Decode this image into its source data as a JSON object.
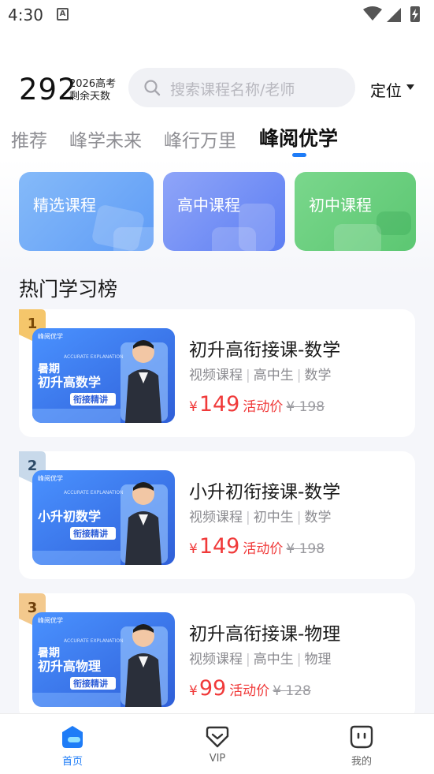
{
  "status_bar": {
    "time": "4:30",
    "notification_icon": "A"
  },
  "header": {
    "countdown_number": "292",
    "countdown_line1": "2026高考",
    "countdown_line2": "剩余天数",
    "search_placeholder": "搜索课程名称/老师",
    "location_label": "定位"
  },
  "tabs": [
    {
      "label": "推荐",
      "active": false
    },
    {
      "label": "峰学未来",
      "active": false
    },
    {
      "label": "峰行万里",
      "active": false
    },
    {
      "label": "峰阅优学",
      "active": true
    }
  ],
  "categories": [
    {
      "label": "精选课程",
      "color": "#6aa6f8"
    },
    {
      "label": "高中课程",
      "color": "#6f8cf5"
    },
    {
      "label": "初中课程",
      "color": "#6cd07f"
    }
  ],
  "section_title": "热门学习榜",
  "courses": [
    {
      "rank": "1",
      "title": "初升高衔接课-数学",
      "tags": [
        "视频课程",
        "高中生",
        "数学"
      ],
      "price_currency": "¥",
      "price": "149",
      "price_label": "活动价",
      "original_price": "¥ 198"
    },
    {
      "rank": "2",
      "title": "小升初衔接课-数学",
      "tags": [
        "视频课程",
        "初中生",
        "数学"
      ],
      "price_currency": "¥",
      "price": "149",
      "price_label": "活动价",
      "original_price": "¥ 198"
    },
    {
      "rank": "3",
      "title": "初升高衔接课-物理",
      "tags": [
        "视频课程",
        "高中生",
        "物理"
      ],
      "price_currency": "¥",
      "price": "99",
      "price_label": "活动价",
      "original_price": "¥ 128"
    }
  ],
  "thumbs": [
    {
      "brand": "峰阅优学",
      "line1": "暑期",
      "line2": "初升高数学",
      "line3": "衔接精讲",
      "ribbon": "ACCURATE EXPLANATION"
    },
    {
      "brand": "峰阅优学",
      "line1": "",
      "line2": "小升初数学",
      "line3": "衔接精讲",
      "ribbon": "ACCURATE EXPLANATION"
    },
    {
      "brand": "峰阅优学",
      "line1": "暑期",
      "line2": "初升高物理",
      "line3": "衔接精讲",
      "ribbon": "ACCURATE EXPLANATION"
    }
  ],
  "bottom_nav": [
    {
      "label": "首页",
      "icon": "home-icon",
      "active": true
    },
    {
      "label": "VIP",
      "icon": "vip-icon",
      "active": false
    },
    {
      "label": "我的",
      "icon": "profile-icon",
      "active": false
    }
  ],
  "colors": {
    "accent": "#1e7cf7",
    "price": "#f03a3a",
    "rank_gold": "#f5c66b",
    "rank_silver": "#c8d9ea"
  }
}
